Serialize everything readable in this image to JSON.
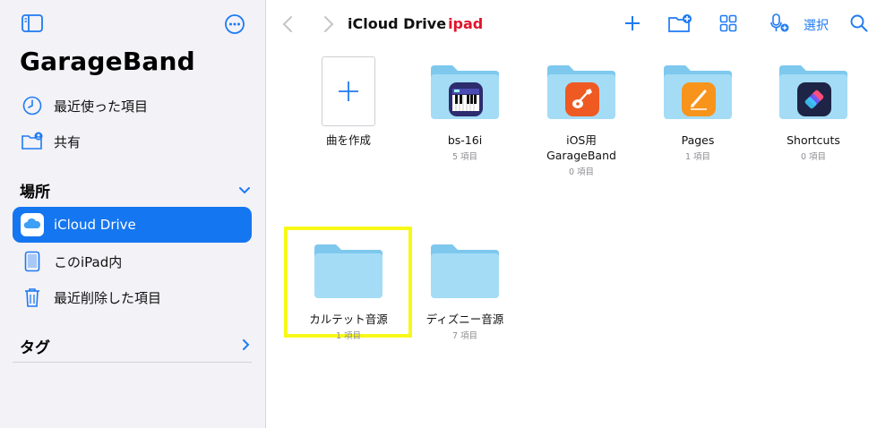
{
  "sidebar": {
    "app_title": "GarageBand",
    "items": [
      {
        "label": "最近使った項目",
        "icon": "clock-icon"
      },
      {
        "label": "共有",
        "icon": "shared-folder-icon"
      }
    ],
    "locations_header": "場所",
    "locations": [
      {
        "label": "iCloud Drive",
        "icon": "icloud-icon",
        "selected": true
      },
      {
        "label": "このiPad内",
        "icon": "ipad-icon"
      },
      {
        "label": "最近削除した項目",
        "icon": "trash-icon"
      }
    ],
    "tags_header": "タグ"
  },
  "toolbar": {
    "title": "iCloud Drive",
    "title_overlay": "ipad",
    "select_label": "選択"
  },
  "files": [
    {
      "name": "曲を作成",
      "count": "",
      "type": "new"
    },
    {
      "name": "bs-16i",
      "count": "5 項目",
      "type": "folder",
      "badge": "keyboard-icon"
    },
    {
      "name": "iOS用\nGarageBand",
      "count": "0 項目",
      "type": "folder",
      "badge": "garageband-icon"
    },
    {
      "name": "Pages",
      "count": "1 項目",
      "type": "folder",
      "badge": "pages-icon"
    },
    {
      "name": "Shortcuts",
      "count": "0 項目",
      "type": "folder",
      "badge": "shortcuts-icon"
    },
    {
      "name": "カルテット音源",
      "count": "1 項目",
      "type": "folder"
    },
    {
      "name": "ディズニー音源",
      "count": "7 項目",
      "type": "folder"
    }
  ],
  "colors": {
    "accent": "#1476f0",
    "highlight": "#f8f818",
    "folder": "#7ec8ee"
  }
}
